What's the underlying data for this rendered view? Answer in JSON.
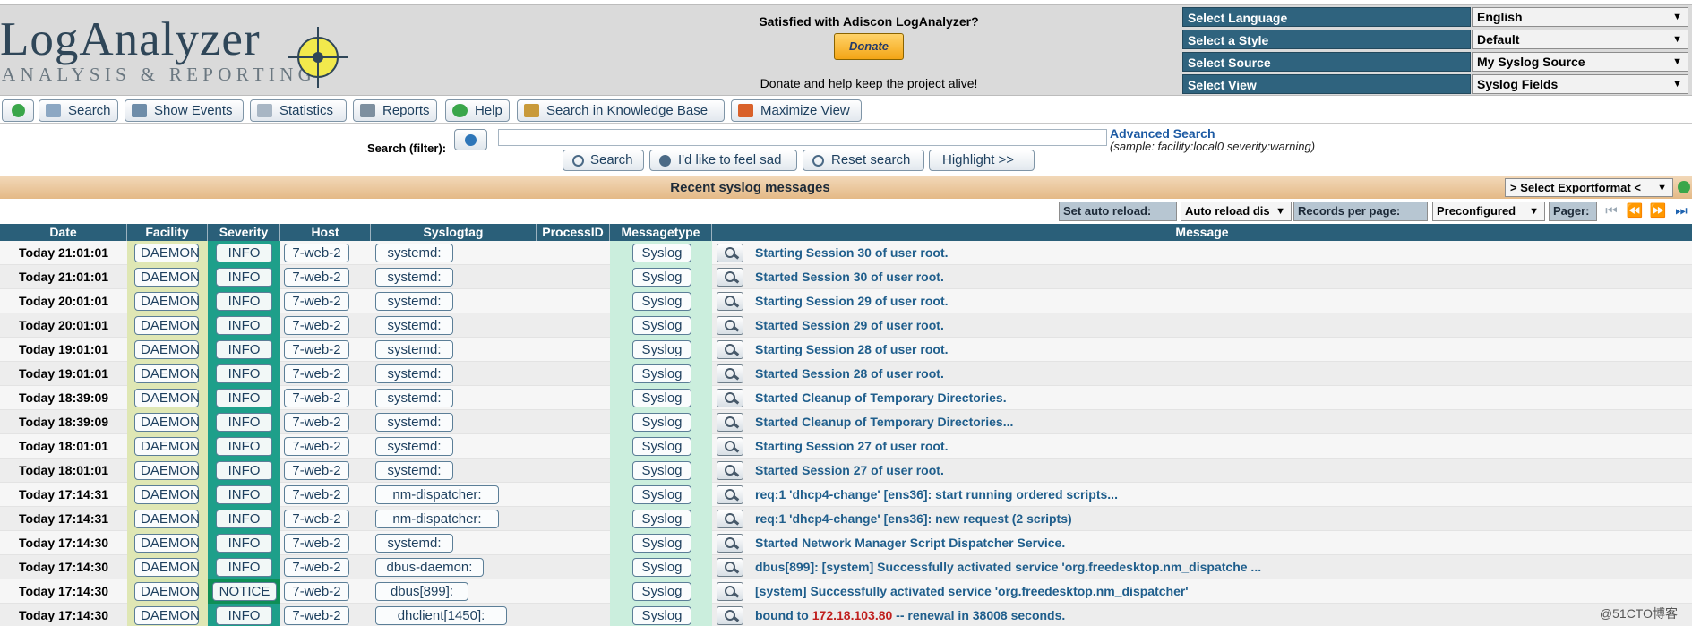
{
  "logo": {
    "title": "LogAnalyzer",
    "subtitle": "ANALYSIS & REPORTING"
  },
  "donate": {
    "question": "Satisfied with Adiscon LogAnalyzer?",
    "button": "Donate",
    "text": "Donate and help keep the project alive!"
  },
  "settings": [
    {
      "label": "Select Language",
      "value": "English"
    },
    {
      "label": "Select a Style",
      "value": "Default"
    },
    {
      "label": "Select Source",
      "value": "My Syslog Source"
    },
    {
      "label": "Select View",
      "value": "Syslog Fields"
    }
  ],
  "toolbar": {
    "search": "Search",
    "show_events": "Show Events",
    "statistics": "Statistics",
    "reports": "Reports",
    "help": "Help",
    "knowledge_base": "Search in Knowledge Base",
    "maximize": "Maximize View"
  },
  "search": {
    "label": "Search (filter):",
    "value": "",
    "advanced": "Advanced Search",
    "sample": "(sample: facility:local0 severity:warning)",
    "btn_search": "Search",
    "btn_sad": "I'd like to feel sad",
    "btn_reset": "Reset search",
    "btn_highlight": "Highlight >>"
  },
  "title": "Recent syslog messages",
  "export": "> Select Exportformat <",
  "controls": {
    "auto_reload_label": "Set auto reload:",
    "auto_reload_value": "Auto reload dis",
    "records_label": "Records per page:",
    "records_value": "Preconfigured",
    "pager_label": "Pager:"
  },
  "columns": [
    "Date",
    "Facility",
    "Severity",
    "Host",
    "Syslogtag",
    "ProcessID",
    "Messagetype",
    "Message"
  ],
  "rows": [
    {
      "date": "Today 21:01:01",
      "facility": "DAEMON",
      "severity": "INFO",
      "host": "7-web-2",
      "tag": "systemd:",
      "type": "Syslog",
      "message": "Starting Session 30 of user root."
    },
    {
      "date": "Today 21:01:01",
      "facility": "DAEMON",
      "severity": "INFO",
      "host": "7-web-2",
      "tag": "systemd:",
      "type": "Syslog",
      "message": "Started Session 30 of user root."
    },
    {
      "date": "Today 20:01:01",
      "facility": "DAEMON",
      "severity": "INFO",
      "host": "7-web-2",
      "tag": "systemd:",
      "type": "Syslog",
      "message": "Starting Session 29 of user root."
    },
    {
      "date": "Today 20:01:01",
      "facility": "DAEMON",
      "severity": "INFO",
      "host": "7-web-2",
      "tag": "systemd:",
      "type": "Syslog",
      "message": "Started Session 29 of user root."
    },
    {
      "date": "Today 19:01:01",
      "facility": "DAEMON",
      "severity": "INFO",
      "host": "7-web-2",
      "tag": "systemd:",
      "type": "Syslog",
      "message": "Starting Session 28 of user root."
    },
    {
      "date": "Today 19:01:01",
      "facility": "DAEMON",
      "severity": "INFO",
      "host": "7-web-2",
      "tag": "systemd:",
      "type": "Syslog",
      "message": "Started Session 28 of user root."
    },
    {
      "date": "Today 18:39:09",
      "facility": "DAEMON",
      "severity": "INFO",
      "host": "7-web-2",
      "tag": "systemd:",
      "type": "Syslog",
      "message": "Started Cleanup of Temporary Directories."
    },
    {
      "date": "Today 18:39:09",
      "facility": "DAEMON",
      "severity": "INFO",
      "host": "7-web-2",
      "tag": "systemd:",
      "type": "Syslog",
      "message": "Started Cleanup of Temporary Directories..."
    },
    {
      "date": "Today 18:01:01",
      "facility": "DAEMON",
      "severity": "INFO",
      "host": "7-web-2",
      "tag": "systemd:",
      "type": "Syslog",
      "message": "Starting Session 27 of user root."
    },
    {
      "date": "Today 18:01:01",
      "facility": "DAEMON",
      "severity": "INFO",
      "host": "7-web-2",
      "tag": "systemd:",
      "type": "Syslog",
      "message": "Started Session 27 of user root."
    },
    {
      "date": "Today 17:14:31",
      "facility": "DAEMON",
      "severity": "INFO",
      "host": "7-web-2",
      "tag": "nm-dispatcher:",
      "type": "Syslog",
      "message": "req:1 'dhcp4-change' [ens36]: start running ordered scripts..."
    },
    {
      "date": "Today 17:14:31",
      "facility": "DAEMON",
      "severity": "INFO",
      "host": "7-web-2",
      "tag": "nm-dispatcher:",
      "type": "Syslog",
      "message": "req:1 'dhcp4-change' [ens36]: new request (2 scripts)"
    },
    {
      "date": "Today 17:14:30",
      "facility": "DAEMON",
      "severity": "INFO",
      "host": "7-web-2",
      "tag": "systemd:",
      "type": "Syslog",
      "message": "Started Network Manager Script Dispatcher Service."
    },
    {
      "date": "Today 17:14:30",
      "facility": "DAEMON",
      "severity": "INFO",
      "host": "7-web-2",
      "tag": "dbus-daemon:",
      "type": "Syslog",
      "message": "dbus[899]: [system] Successfully activated service 'org.freedesktop.nm_dispatche ..."
    },
    {
      "date": "Today 17:14:30",
      "facility": "DAEMON",
      "severity": "NOTICE",
      "host": "7-web-2",
      "tag": "dbus[899]:",
      "type": "Syslog",
      "message": "[system] Successfully activated service 'org.freedesktop.nm_dispatcher'"
    },
    {
      "date": "Today 17:14:30",
      "facility": "DAEMON",
      "severity": "INFO",
      "host": "7-web-2",
      "tag": "dhclient[1450]:",
      "type": "Syslog",
      "message": "bound to ",
      "message_ip": "172.18.103.80",
      "message_rest": " -- renewal in 38008 seconds."
    }
  ],
  "watermark": "@51CTO博客",
  "colors": {
    "header_bg": "#dadada",
    "label_blue": "#2f637e",
    "table_head": "#2a5f79",
    "severity_info": "#1e9f8a",
    "severity_notice": "#0e8f56",
    "facility_bg": "#dfe7b4",
    "msgtype_bg": "#cbeedd",
    "title_bar": "#e4b986",
    "link": "#1f5e8c"
  }
}
